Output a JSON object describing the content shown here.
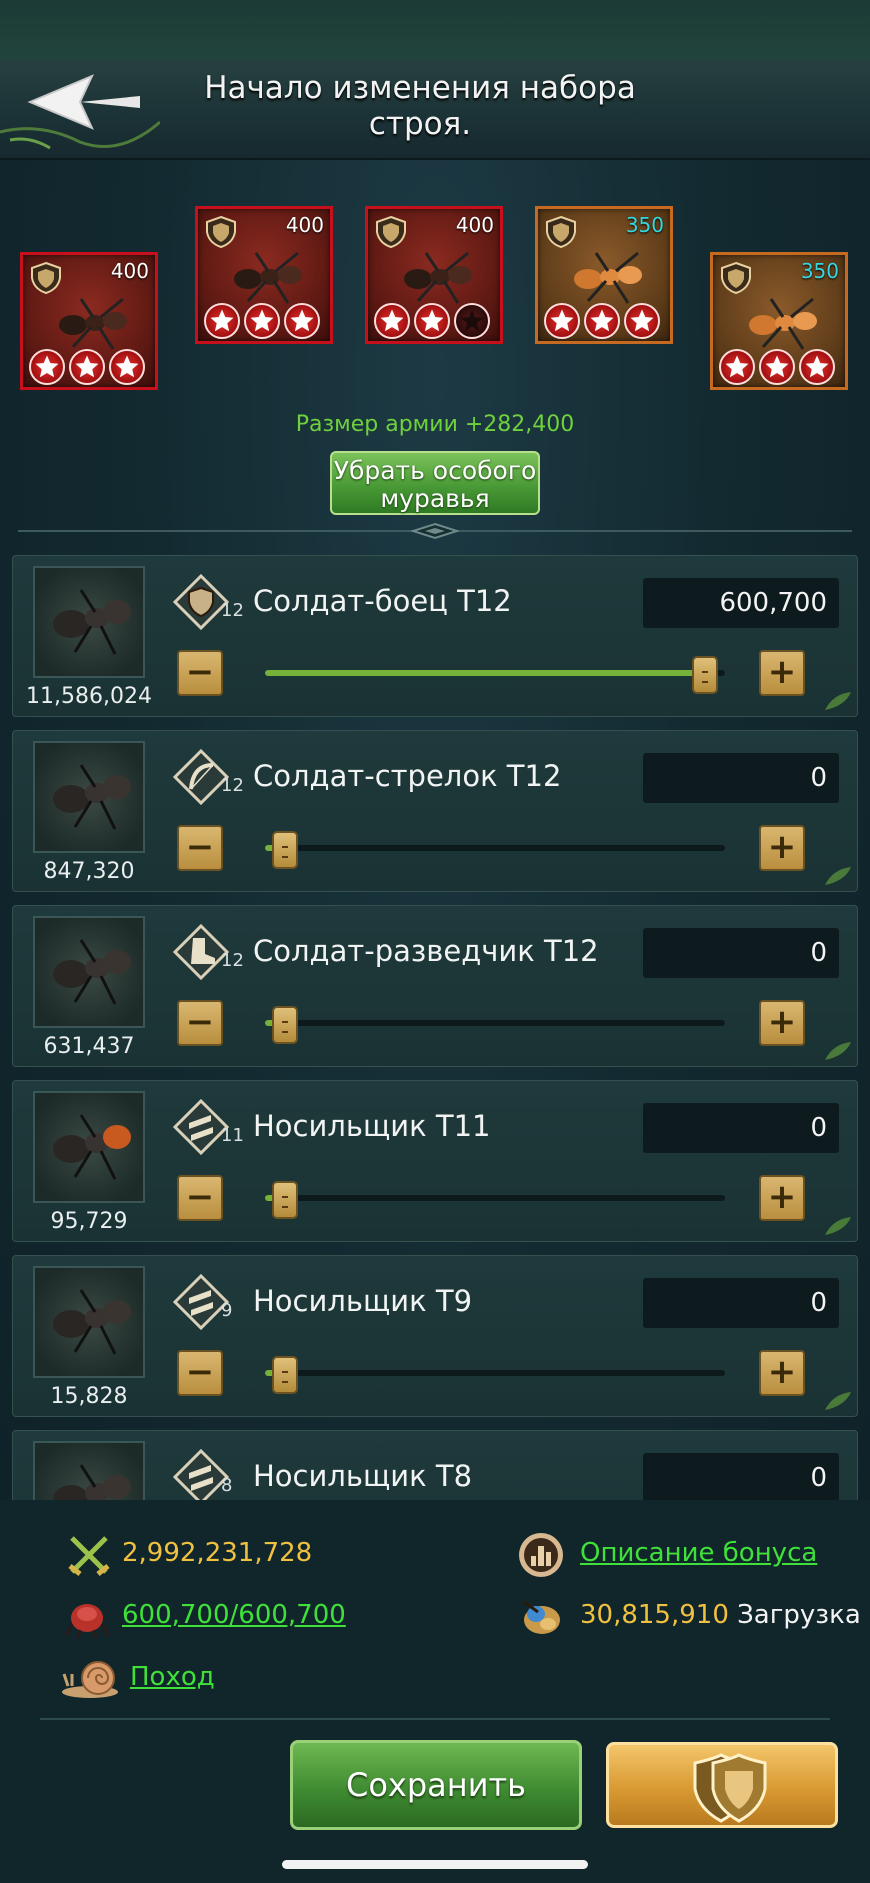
{
  "header": {
    "title": "Начало изменения набора строя."
  },
  "special_ants": [
    {
      "level": "400",
      "stars": 3,
      "frame": "red",
      "level_color": "white"
    },
    {
      "level": "400",
      "stars": 3,
      "frame": "red",
      "level_color": "white"
    },
    {
      "level": "400",
      "stars": 2,
      "frame": "red",
      "level_color": "white"
    },
    {
      "level": "350",
      "stars": 3,
      "frame": "gold",
      "level_color": "cyan"
    },
    {
      "level": "350",
      "stars": 3,
      "frame": "gold",
      "level_color": "cyan"
    }
  ],
  "army_size": "Размер армии +282,400",
  "remove_special_button": "Убрать особого муравья",
  "troops": [
    {
      "name": "Солдат-боец T12",
      "tier": "12",
      "count": "11,586,024",
      "value": "600,700",
      "slider_fraction": 1.0,
      "icon": "shield-icon"
    },
    {
      "name": "Солдат-стрелок T12",
      "tier": "12",
      "count": "847,320",
      "value": "0",
      "slider_fraction": 0.0,
      "icon": "bow-icon"
    },
    {
      "name": "Солдат-разведчик T12",
      "tier": "12",
      "count": "631,437",
      "value": "0",
      "slider_fraction": 0.0,
      "icon": "boot-icon"
    },
    {
      "name": "Носильщик T11",
      "tier": "11",
      "count": "95,729",
      "value": "0",
      "slider_fraction": 0.0,
      "icon": "carry-icon"
    },
    {
      "name": "Носильщик T9",
      "tier": "9",
      "count": "15,828",
      "value": "0",
      "slider_fraction": 0.0,
      "icon": "carry-icon"
    },
    {
      "name": "Носильщик T8",
      "tier": "8",
      "count": "",
      "value": "0",
      "slider_fraction": 0.0,
      "icon": "carry-icon"
    }
  ],
  "summary": {
    "power": "2,992,231,728",
    "bonus_link": "Описание бонуса",
    "troops_link": "600,700/600,700",
    "load_value": "30,815,910",
    "load_label": "Загрузка",
    "march_link": "Поход"
  },
  "save_button": "Сохранить"
}
